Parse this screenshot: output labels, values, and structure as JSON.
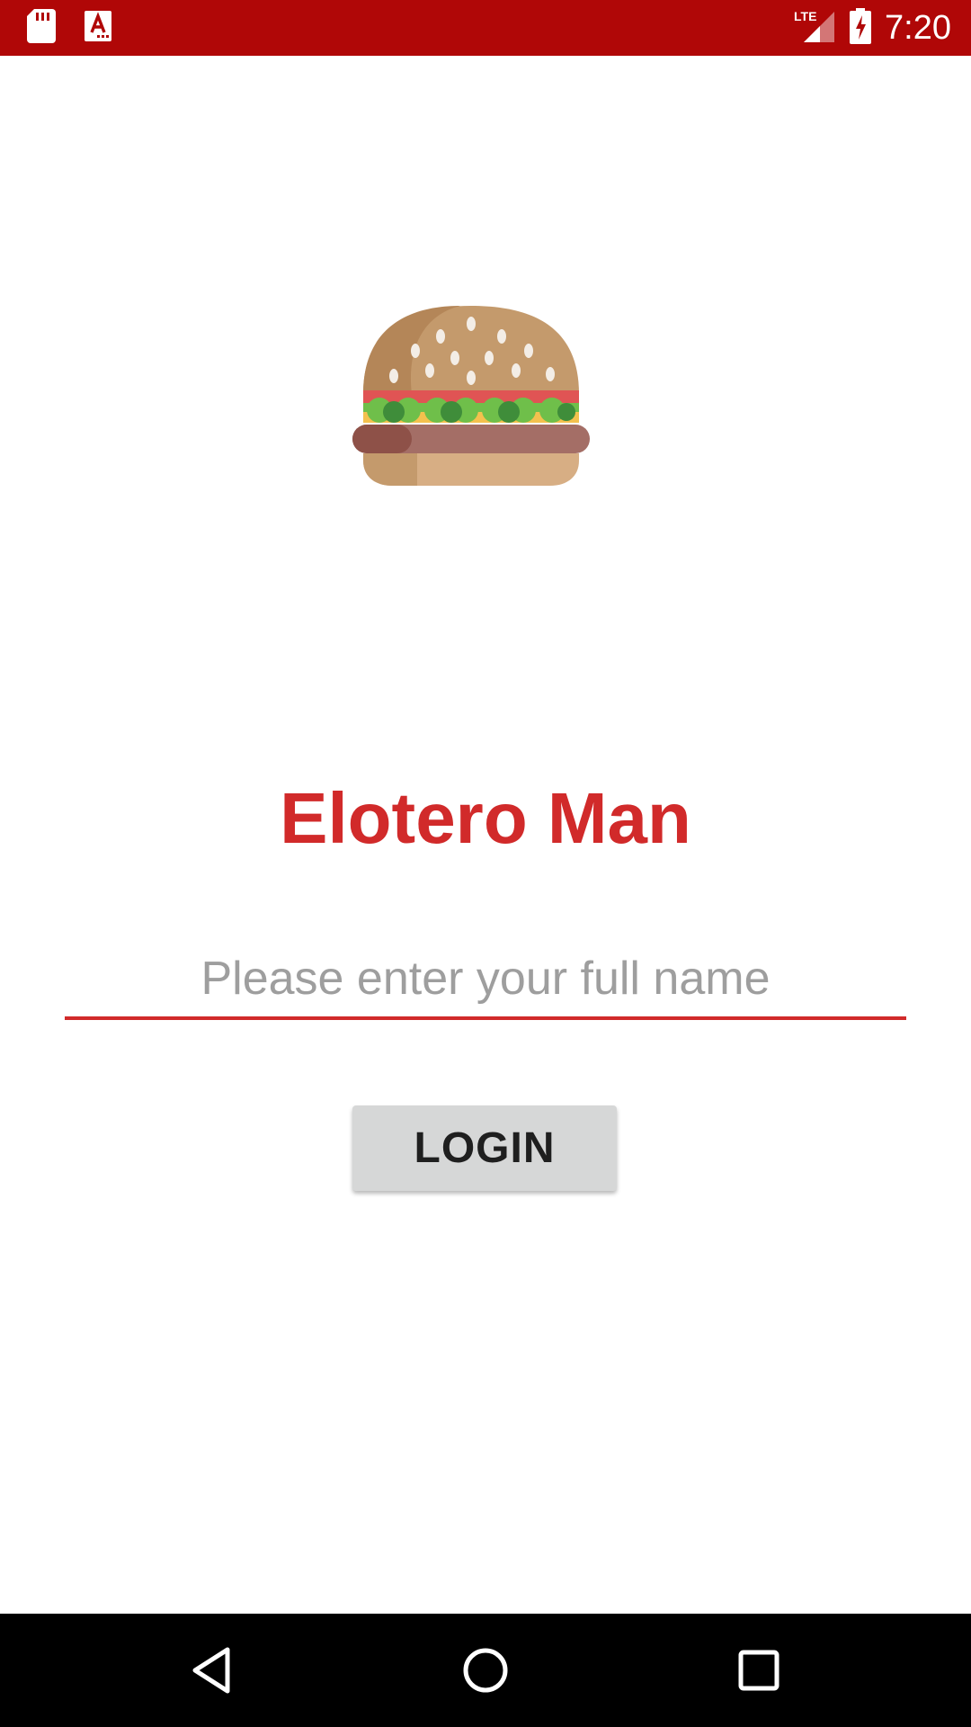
{
  "status_bar": {
    "time": "7:20",
    "network": "LTE",
    "background_color": "#b00707",
    "icons_left": [
      "sd-card-icon",
      "text-a-icon"
    ],
    "icons_right": [
      "lte-signal-icon",
      "battery-charging-icon"
    ]
  },
  "app": {
    "logo_icon": "hamburger-icon",
    "title": "Elotero Man",
    "accent_color": "#d12a2a"
  },
  "login_form": {
    "name_placeholder": "Please enter your full name",
    "name_value": "",
    "login_label": "LOGIN"
  },
  "nav_bar": {
    "buttons": [
      "back-icon",
      "home-icon",
      "recents-icon"
    ]
  }
}
